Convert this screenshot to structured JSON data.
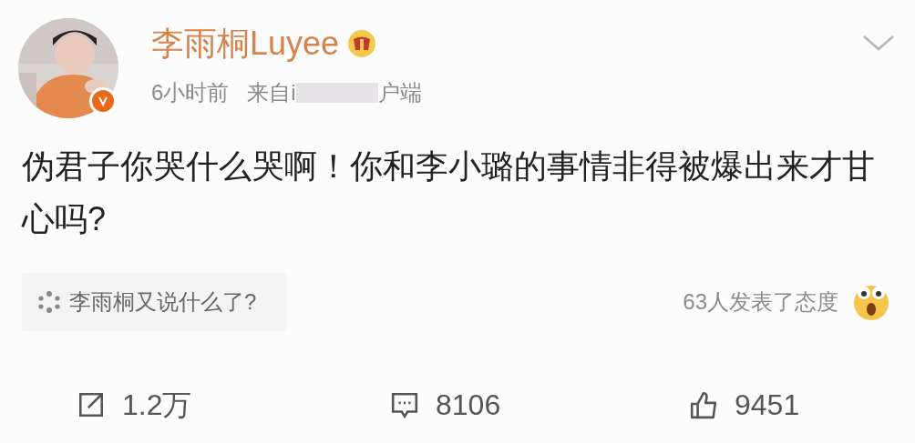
{
  "post": {
    "author": "李雨桐Luyee",
    "time": "6小时前",
    "source_start": "来自i",
    "source_end": "户端",
    "body": "伪君子你哭什么哭啊！你和李小璐的事情非得被爆出来才甘心吗?"
  },
  "topic": {
    "label": "李雨桐又说什么了?"
  },
  "reactions": {
    "label": "63人发表了态度"
  },
  "actions": [
    {
      "kind": "repost",
      "count": "1.2万"
    },
    {
      "kind": "comment",
      "count": "8106"
    },
    {
      "kind": "like",
      "count": "9451"
    }
  ]
}
